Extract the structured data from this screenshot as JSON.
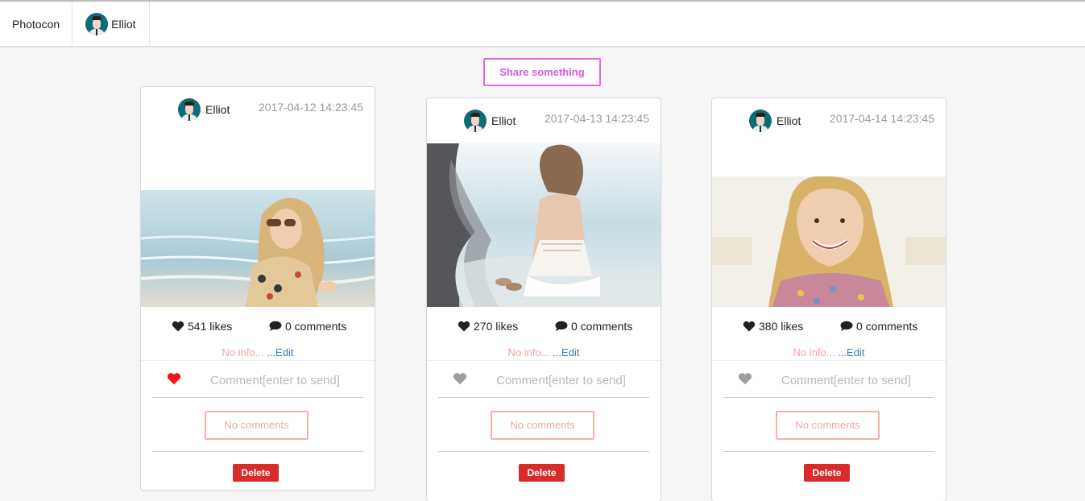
{
  "navbar": {
    "brand": "Photocon",
    "user": {
      "name": "Elliot",
      "avatar_icon": "user-avatar"
    }
  },
  "share_button": {
    "label": "Share something",
    "color": "#d85ae2"
  },
  "posts": [
    {
      "author": "Elliot",
      "date": "2017-04-12 14:23:45",
      "likes": "541 likes",
      "comments": "0 comments",
      "info": "No info...",
      "edit_label": " ...Edit",
      "comment_placeholder": "Comment[enter to send]",
      "liked": true,
      "no_comments_label": "No comments",
      "delete_label": "Delete"
    },
    {
      "author": "Elliot",
      "date": "2017-04-13 14:23:45",
      "likes": "270 likes",
      "comments": "0 comments",
      "info": "No info...",
      "edit_label": " ...Edit",
      "comment_placeholder": "Comment[enter to send]",
      "liked": false,
      "no_comments_label": "No comments",
      "delete_label": "Delete"
    },
    {
      "author": "Elliot",
      "date": "2017-04-14 14:23:45",
      "likes": "380 likes",
      "comments": "0 comments",
      "info": "No info...",
      "edit_label": " ...Edit",
      "comment_placeholder": "Comment[enter to send]",
      "liked": false,
      "no_comments_label": "No comments",
      "delete_label": "Delete"
    }
  ],
  "colors": {
    "liked_heart": "#f01414",
    "unliked_heart": "#9e9e9e",
    "delete": "#d92b2b",
    "edit_link": "#3b7dc4",
    "info_text": "#f4a3a3"
  }
}
